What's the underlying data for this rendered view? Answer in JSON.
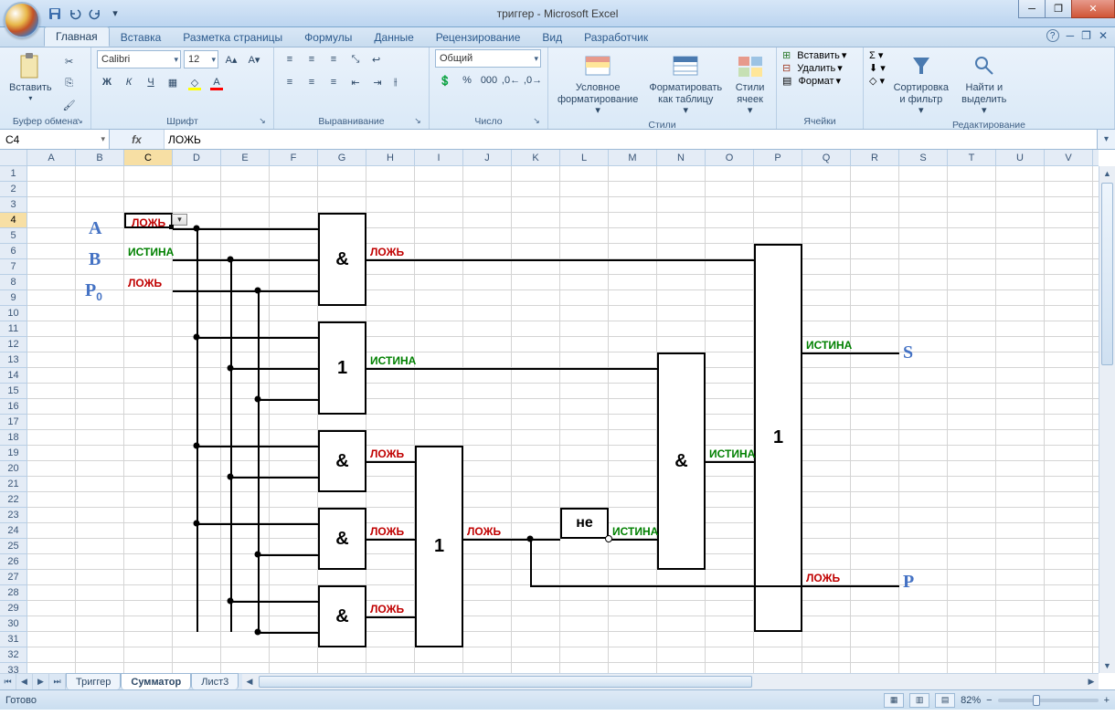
{
  "title": "триггер - Microsoft Excel",
  "tabs": {
    "items": [
      "Главная",
      "Вставка",
      "Разметка страницы",
      "Формулы",
      "Данные",
      "Рецензирование",
      "Вид",
      "Разработчик"
    ],
    "active": 0
  },
  "ribbon": {
    "clipboard": {
      "label": "Буфер обмена",
      "paste": "Вставить"
    },
    "font": {
      "label": "Шрифт",
      "name": "Calibri",
      "size": "12",
      "bold": "Ж",
      "italic": "К",
      "underline": "Ч"
    },
    "align": {
      "label": "Выравнивание"
    },
    "number": {
      "label": "Число",
      "format": "Общий"
    },
    "styles": {
      "label": "Стили",
      "cond": "Условное форматирование",
      "table": "Форматировать как таблицу",
      "cell": "Стили ячеек"
    },
    "cells": {
      "label": "Ячейки",
      "insert": "Вставить",
      "delete": "Удалить",
      "format": "Формат"
    },
    "editing": {
      "label": "Редактирование",
      "sort": "Сортировка и фильтр",
      "find": "Найти и выделить"
    }
  },
  "fbar": {
    "name": "C4",
    "fx": "fx",
    "value": "ЛОЖЬ"
  },
  "columns": [
    "A",
    "B",
    "C",
    "D",
    "E",
    "F",
    "G",
    "H",
    "I",
    "J",
    "K",
    "L",
    "M",
    "N",
    "O",
    "P",
    "Q",
    "R",
    "S",
    "T",
    "U",
    "V"
  ],
  "col_count_visible": 22,
  "row_count_visible": 33,
  "selected": {
    "col": "C",
    "row": 4
  },
  "sheet_tabs": {
    "items": [
      "Триггер",
      "Сумматор",
      "Лист3"
    ],
    "active": 1
  },
  "status": {
    "ready": "Готово",
    "zoom": "82%"
  },
  "logic": {
    "inputs": {
      "A": "A",
      "B": "B",
      "P0": "P",
      "P0sub": "0"
    },
    "outputs": {
      "S": "S",
      "P": "P"
    },
    "gates": {
      "and1": "&",
      "or1": "1",
      "and2": "&",
      "and3": "&",
      "and4": "&",
      "or2": "1",
      "not": "не",
      "and5": "&",
      "or3": "1"
    },
    "vals": {
      "c4": "ЛОЖЬ",
      "c6": "ИСТИНА",
      "c8": "ЛОЖЬ",
      "h6": "ЛОЖЬ",
      "h13": "ИСТИНА",
      "h19": "ЛОЖЬ",
      "h24": "ЛОЖЬ",
      "h29": "ЛОЖЬ",
      "j24": "ЛОЖЬ",
      "m24": "ИСТИНА",
      "o19": "ИСТИНА",
      "q12": "ИСТИНА",
      "q27": "ЛОЖЬ"
    }
  }
}
